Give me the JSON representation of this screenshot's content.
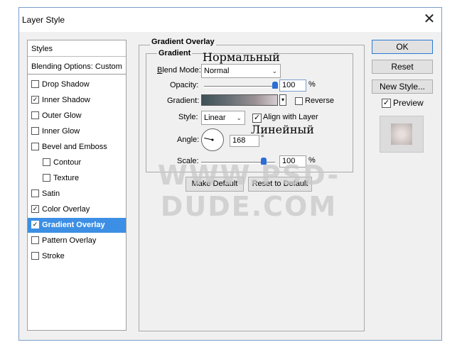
{
  "window": {
    "title": "Layer Style",
    "close_glyph": "✕"
  },
  "style_list": {
    "items": [
      {
        "label": "Styles",
        "checkbox": null
      },
      {
        "label": "Blending Options: Custom",
        "checkbox": null
      },
      {
        "label": "Drop Shadow",
        "checkbox": false
      },
      {
        "label": "Inner Shadow",
        "checkbox": true
      },
      {
        "label": "Outer Glow",
        "checkbox": false
      },
      {
        "label": "Inner Glow",
        "checkbox": false
      },
      {
        "label": "Bevel and Emboss",
        "checkbox": false
      },
      {
        "label": "Contour",
        "checkbox": false
      },
      {
        "label": "Texture",
        "checkbox": false
      },
      {
        "label": "Satin",
        "checkbox": false
      },
      {
        "label": "Color Overlay",
        "checkbox": true
      },
      {
        "label": "Gradient Overlay",
        "checkbox": true,
        "selected": true
      },
      {
        "label": "Pattern Overlay",
        "checkbox": false
      },
      {
        "label": "Stroke",
        "checkbox": false
      }
    ]
  },
  "gradient_overlay": {
    "group_title": "Gradient Overlay",
    "sub_title": "Gradient",
    "blend_mode": {
      "label": "Blend Mode:",
      "value": "Normal"
    },
    "opacity": {
      "label": "Opacity:",
      "value": "100",
      "unit": "%",
      "level": 100
    },
    "gradient": {
      "label": "Gradient:",
      "reverse_label": "Reverse",
      "reverse": false
    },
    "style": {
      "label": "Style:",
      "value": "Linear",
      "align_label": "Align with Layer",
      "align": true
    },
    "angle": {
      "label": "Angle:",
      "value": "168",
      "unit": "°"
    },
    "scale": {
      "label": "Scale:",
      "value": "100",
      "unit": "%",
      "level": 100
    },
    "make_default": "Make Default",
    "reset_default": "Reset to Default"
  },
  "annotations": {
    "normal_ru": "Нормальный",
    "linear_ru": "Линейный"
  },
  "watermark": "WWW.PSD-DUDE.COM",
  "buttons": {
    "ok": "OK",
    "reset": "Reset",
    "new_style": "New Style...",
    "preview_label": "Preview",
    "preview": true
  },
  "colors": {
    "accent": "#3c8fe4",
    "gradient_start": "#3d5156",
    "gradient_end": "#d4cdd0"
  }
}
